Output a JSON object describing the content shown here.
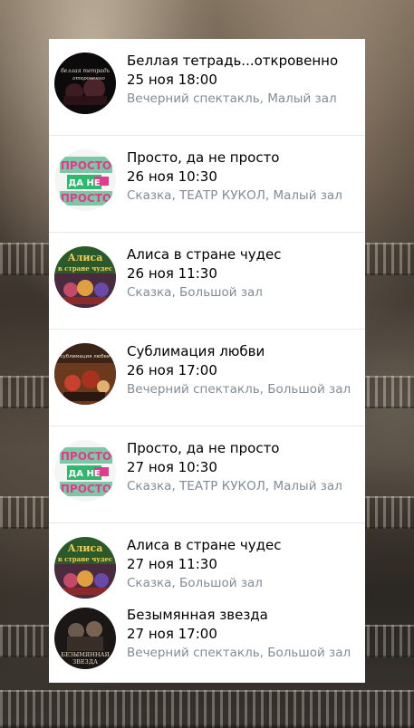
{
  "events": [
    {
      "title": "Беллая тетрадь...откровенно",
      "datetime": "25 ноя 18:00",
      "meta": "Вечерний спектакль, Малый зал",
      "thumb_icon": "poster-belaya-tetrad-icon",
      "thumb_text_1": "беллая тетрадь",
      "thumb_text_2": "откровенно"
    },
    {
      "title": "Просто, да не просто",
      "datetime": "26 ноя 10:30",
      "meta": "Сказка, ТЕАТР КУКОЛ, Малый зал",
      "thumb_icon": "poster-prosto-icon",
      "thumb_text_1": "ПРОСТО",
      "thumb_text_2": "ДА НЕ",
      "thumb_text_3": "ПРОСТО"
    },
    {
      "title": "Алиса в стране чудес",
      "datetime": "26 ноя 11:30",
      "meta": "Сказка, Большой зал",
      "thumb_icon": "poster-alisa-icon",
      "thumb_text_1": "Алиса",
      "thumb_text_2": "в стране чудес"
    },
    {
      "title": "Сублимация любви",
      "datetime": "26 ноя 17:00",
      "meta": "Вечерний спектакль, Большой зал",
      "thumb_icon": "poster-sublimaciya-icon",
      "thumb_text_1": "сублимация любви"
    },
    {
      "title": "Просто, да не просто",
      "datetime": "27 ноя 10:30",
      "meta": "Сказка, ТЕАТР КУКОЛ, Малый зал",
      "thumb_icon": "poster-prosto-icon",
      "thumb_text_1": "ПРОСТО",
      "thumb_text_2": "ДА НЕ",
      "thumb_text_3": "ПРОСТО"
    },
    {
      "title": "Алиса в стране чудес",
      "datetime": "27 ноя 11:30",
      "meta": "Сказка, Большой зал",
      "thumb_icon": "poster-alisa-icon",
      "thumb_text_1": "Алиса",
      "thumb_text_2": "в стране чудес"
    },
    {
      "title": "Безымянная звезда",
      "datetime": "27 ноя 17:00",
      "meta": "Вечерний спектакль, Большой зал",
      "thumb_icon": "poster-bezymyannaya-zvezda-icon",
      "thumb_text_1": "БЕЗЫМЯННАЯ",
      "thumb_text_2": "ЗВЕЗДА"
    }
  ],
  "colors": {
    "title": "#000000",
    "meta": "#818c99",
    "divider": "#e7e8ec",
    "card": "#ffffff"
  }
}
